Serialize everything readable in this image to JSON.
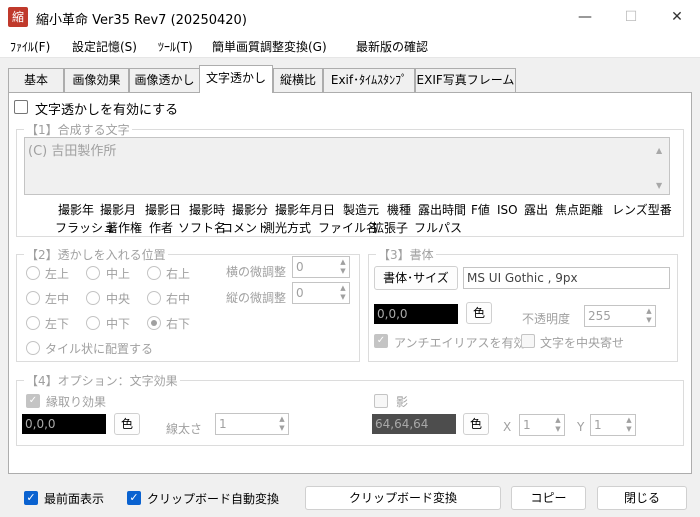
{
  "window": {
    "app_icon_glyph": "縮",
    "title": "縮小革命 Ver35 Rev7 (20250420)",
    "controls": [
      "—",
      "☐",
      "✕"
    ]
  },
  "menu": [
    "ﾌｧｲﾙ(F)",
    "設定記憶(S)",
    "ﾂｰﾙ(T)",
    "簡単画質調整変換(G)",
    "最新版の確認"
  ],
  "tabs": [
    "基本",
    "画像効果",
    "画像透かし",
    "文字透かし",
    "縦横比",
    "Exif･ﾀｲﾑｽﾀﾝﾌﾟ",
    "EXIF写真フレーム"
  ],
  "active_tab": "文字透かし",
  "enable_label": "文字透かしを有効にする",
  "section1": {
    "title": "【1】合成する文字",
    "text_value": "(C) 吉田製作所",
    "keywords_row1": [
      "撮影年",
      "撮影月",
      "撮影日",
      "撮影時",
      "撮影分",
      "撮影年月日",
      "製造元",
      "機種",
      "露出時間",
      "F値",
      "ISO",
      "露出",
      "焦点距離",
      "レンズ型番"
    ],
    "keywords_row2": [
      "フラッシュ",
      "著作権",
      "作者",
      "ソフト名",
      "コメント",
      "測光方式",
      "ファイル名",
      "拡張子",
      "フルパス"
    ]
  },
  "section2": {
    "title": "【2】透かしを入れる位置",
    "positions": [
      "左上",
      "中上",
      "右上",
      "左中",
      "中央",
      "右中",
      "左下",
      "中下",
      "右下"
    ],
    "selected": "右下",
    "tile_label": "タイル状に配置する",
    "h_adjust_label": "横の微調整",
    "h_adjust_value": "0",
    "v_adjust_label": "縦の微調整",
    "v_adjust_value": "0"
  },
  "section3": {
    "title": "【3】書体",
    "font_button": "書体･サイズ",
    "font_value": "MS UI Gothic , 9px",
    "color_value": "0,0,0",
    "color_button": "色",
    "opacity_label": "不透明度",
    "opacity_value": "255",
    "antialias_label": "アンチエイリアスを有効",
    "center_label": "文字を中央寄せ"
  },
  "section4": {
    "title": "【4】オプション：文字効果",
    "outline_label": "縁取り効果",
    "outline_color": "0,0,0",
    "outline_color_button": "色",
    "width_label": "線太さ",
    "width_value": "1",
    "shadow_label": "影",
    "shadow_color": "64,64,64",
    "shadow_color_button": "色",
    "x_label": "X",
    "x_value": "1",
    "y_label": "Y",
    "y_value": "1"
  },
  "bottom": {
    "topmost_label": "最前面表示",
    "clipboard_auto_label": "クリップボード自動変換",
    "clipboard_button": "クリップボード変換",
    "copy_button": "コピー",
    "close_button": "閉じる"
  },
  "colors": {
    "accent": "#0a62d0",
    "disabled": "#a0a0a0"
  }
}
